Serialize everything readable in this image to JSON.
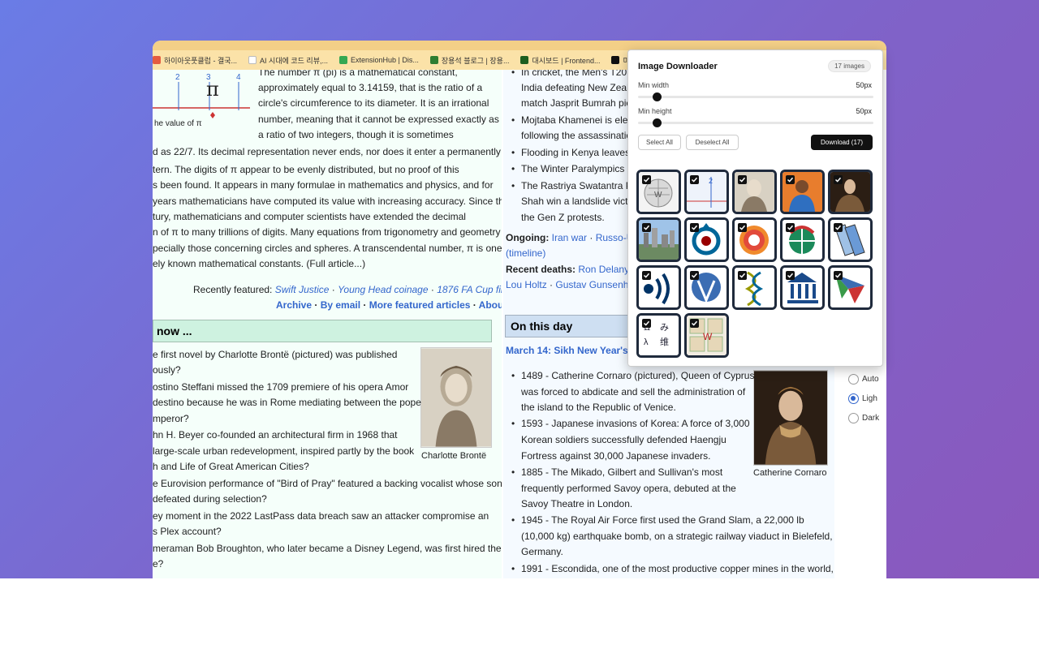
{
  "browser": {
    "bookmarks": [
      {
        "label": "하이아웃풋클럽 - 결국...",
        "color": "#e45b3f"
      },
      {
        "label": "AI 시대에 코드 리뷰,...",
        "color": "#ffffff"
      },
      {
        "label": "ExtensionHub | Dis...",
        "color": "#34a853"
      },
      {
        "label": "장용석 블로그 | 장용...",
        "color": "#2e7d32"
      },
      {
        "label": "대시보드 | Frontend...",
        "color": "#1b5e20"
      },
      {
        "label": "미",
        "color": "#111111"
      }
    ]
  },
  "featured": {
    "para_lines": [
      "The number π (pi) is a mathematical constant,",
      "approximately equal to 3.14159, that is the ratio of a",
      "circle's circumference to its diameter. It is an irrational",
      "number, meaning that it cannot be expressed exactly as",
      "a ratio of two integers, though it is sometimes",
      "d as 22/7. Its decimal representation never ends, nor does it enter a permanently",
      "tern. The digits of π appear to be evenly distributed, but no proof of this",
      "s been found. It appears in many formulae in mathematics and physics, and for",
      "years mathematicians have computed its value with increasing accuracy. Since the",
      "tury, mathematicians and computer scientists have extended the decimal",
      "n of π to many trillions of digits. Many equations from trigonometry and geometry",
      "pecially those concerning circles and spheres. A transcendental number, π is one of",
      "ely known mathematical constants. (Full article...)"
    ],
    "fig_caption": "he value of π",
    "fig_ticks": [
      "2",
      "3",
      "4"
    ],
    "recently_label": "Recently featured:",
    "recently_items": [
      "Swift Justice",
      "Young Head coinage",
      "1876 FA Cup final"
    ],
    "footer_links": [
      "Archive",
      "By email",
      "More featured articles",
      "About"
    ]
  },
  "dyk": {
    "heading": "now ...",
    "lines": [
      "e first novel by Charlotte Brontë (pictured) was published",
      "ously?",
      "ostino Steffani missed the 1709 premiere of his opera Amor",
      "destino because he was in Rome mediating between the pope",
      "mperor?",
      "hn H. Beyer co-founded an architectural firm in 1968 that",
      "large-scale urban redevelopment, inspired partly by the book",
      "h and Life of Great American Cities?",
      "e Eurovision performance of \"Bird of Pray\" featured a backing vocalist whose song",
      "defeated during selection?",
      "ey moment in the 2022 LastPass data breach saw an attacker compromise an",
      "s Plex account?",
      "meraman Bob Broughton, who later became a Disney Legend, was first hired there",
      "e?"
    ],
    "image_caption": "Charlotte Brontë"
  },
  "news": {
    "lines": [
      "In cricket, the Men's T20 ...",
      "India defeating New Zeala...",
      "match Jasprit Bumrah pic...",
      "Mojtaba Khamenei is elec...",
      "following the assassination...",
      "Flooding in Kenya leaves ...",
      "The Winter Paralympics ...",
      "The Rastriya Swatantra Pa...",
      "Shah win a landslide victor...",
      "the Gen Z protests."
    ],
    "ongoing_label": "Ongoing:",
    "ongoing_items": [
      "Iran war",
      "Russo-Uk..."
    ],
    "timeline": "(timeline)",
    "recent_deaths_label": "Recent deaths:",
    "recent_deaths": [
      "Ron Delany",
      "Lou Holtz",
      "Gustav Gunsenhei..."
    ]
  },
  "otd": {
    "heading": "On this day",
    "date_line": "March 14: Sikh New Year's D...",
    "lines": [
      "1489 - Catherine Cornaro (pictured), Queen of Cyprus,",
      "was forced to abdicate and sell the administration of",
      "the island to the Republic of Venice.",
      "1593 - Japanese invasions of Korea: A force of 3,000",
      "Korean soldiers successfully defended Haengju",
      "Fortress against 30,000 Japanese invaders.",
      "1885 - The Mikado, Gilbert and Sullivan's most",
      "frequently performed Savoy opera, debuted at the",
      "Savoy Theatre in London.",
      "1945 - The Royal Air Force first used the Grand Slam, a 22,000 lb",
      "(10,000 kg) earthquake bomb, on a strategic railway viaduct in Bielefeld,",
      "Germany.",
      "1991 - Escondida, one of the most productive copper mines in the world,"
    ],
    "image_caption": "Catherine Cornaro"
  },
  "appearance": {
    "options": [
      "Auto",
      "Ligh",
      "Dark"
    ],
    "selected": 1
  },
  "popup": {
    "title": "Image Downloader",
    "count_badge": "17 images",
    "min_width_label": "Min width",
    "min_width_value": "50px",
    "min_width_fraction": 0.08,
    "min_height_label": "Min height",
    "min_height_value": "50px",
    "min_height_fraction": 0.08,
    "select_all": "Select All",
    "deselect_all": "Deselect All",
    "download": "Download (17)",
    "images": [
      {
        "name": "wikipedia-globe",
        "checked": true
      },
      {
        "name": "pi-diagram",
        "checked": true
      },
      {
        "name": "charlotte-bronte",
        "checked": true
      },
      {
        "name": "cricketer",
        "checked": true
      },
      {
        "name": "catherine-cornaro",
        "checked": true
      },
      {
        "name": "city-skyline",
        "checked": true
      },
      {
        "name": "commons-logo",
        "checked": true
      },
      {
        "name": "wikiquote-flower",
        "checked": true
      },
      {
        "name": "wikispecies-globe",
        "checked": true
      },
      {
        "name": "wikibooks-logo",
        "checked": true
      },
      {
        "name": "wikisource-logo",
        "checked": true
      },
      {
        "name": "wikinews-logo",
        "checked": true
      },
      {
        "name": "wikidata-dna",
        "checked": true
      },
      {
        "name": "wikiversity-logo",
        "checked": true
      },
      {
        "name": "wikivoyage-logo",
        "checked": true
      },
      {
        "name": "wiktionary-logo",
        "checked": true
      },
      {
        "name": "wiktionary-tiles",
        "checked": true
      }
    ]
  }
}
